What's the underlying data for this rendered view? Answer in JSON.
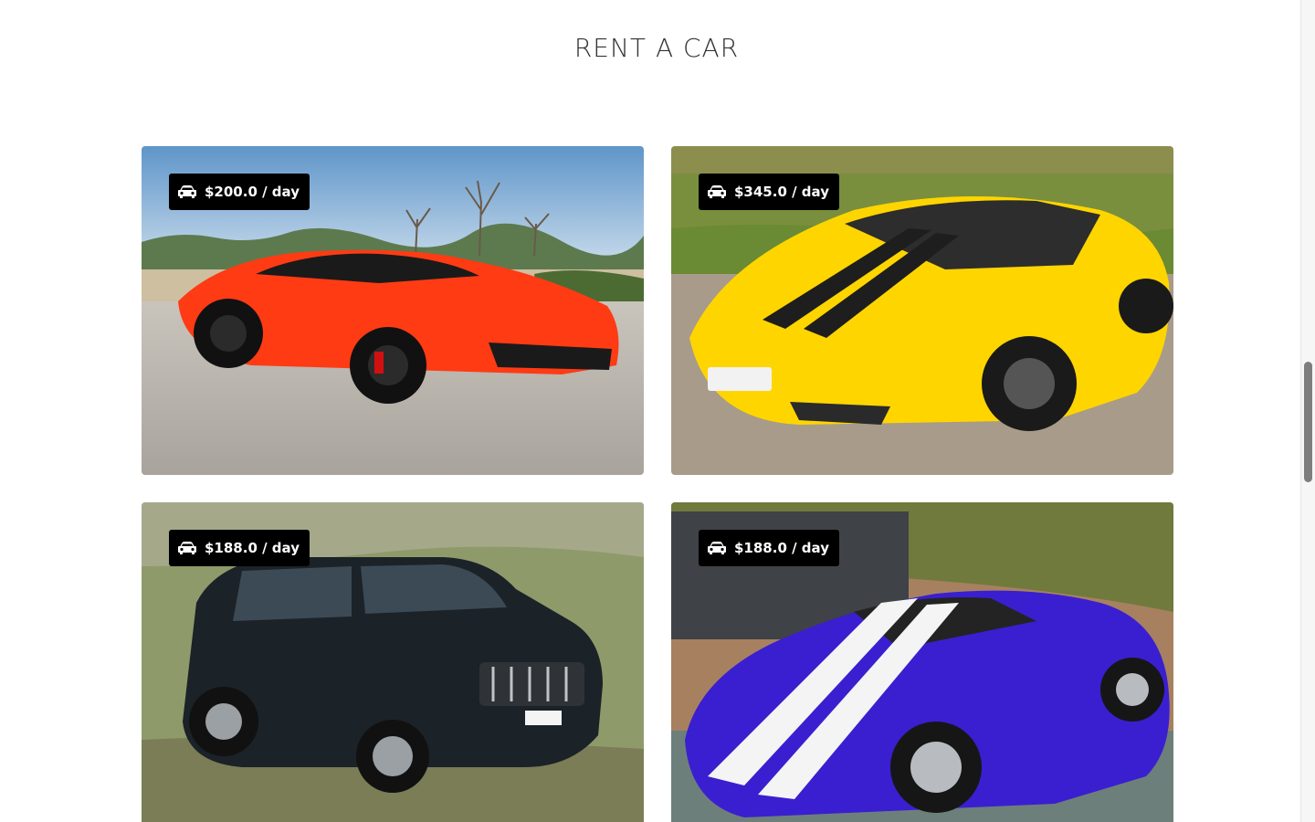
{
  "section": {
    "title": "RENT A CAR"
  },
  "cars": [
    {
      "price": "$200.0 / day",
      "body_color": "#ff3b14",
      "photo": "red sports coupe"
    },
    {
      "price": "$345.0 / day",
      "body_color": "#ffd500",
      "photo": "yellow sports car with black stripes"
    },
    {
      "price": "$188.0 / day",
      "body_color": "#1b2228",
      "photo": "black SUV"
    },
    {
      "price": "$188.0 / day",
      "body_color": "#3a1fd0",
      "photo": "blue sports car with white stripes"
    }
  ],
  "icons": {
    "badge_icon": "car-icon"
  },
  "colors": {
    "badge_bg": "#000000",
    "badge_text": "#ffffff",
    "title_text": "#333333"
  }
}
